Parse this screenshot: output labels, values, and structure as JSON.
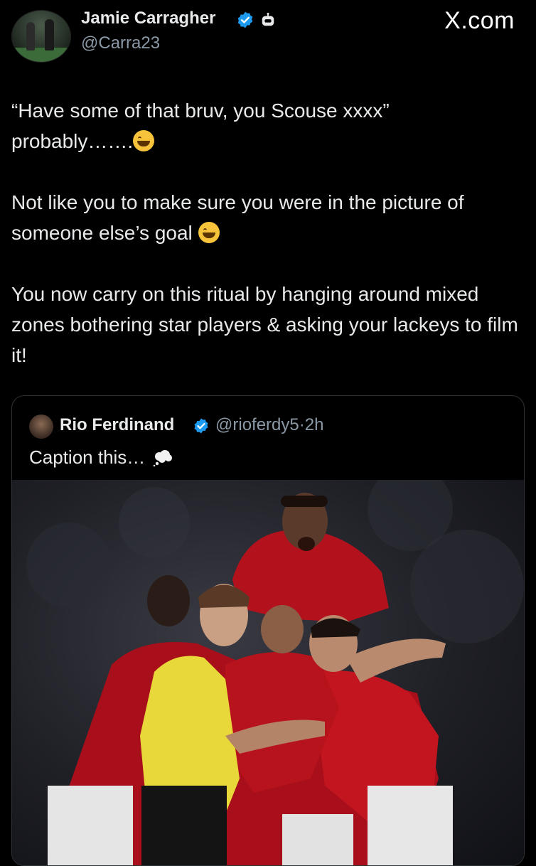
{
  "brand": "X.com",
  "author": {
    "name": "Jamie Carragher",
    "handle": "@Carra23",
    "verified_color": "#1d9bf0"
  },
  "tweet": {
    "p1_line1": "“Have some of that bruv, you Scouse xxxx”",
    "p1_line2": "probably…….",
    "p2": "Not like you to make sure you were in the picture of someone else’s goal",
    "p3": "You now carry on this ritual by hanging around mixed zones bothering star players & asking your lackeys to film it!"
  },
  "quoted": {
    "name": "Rio Ferdinand",
    "handle": "@rioferdy5",
    "separator": "·",
    "time": "2h",
    "text": "Caption this…"
  },
  "icons": {
    "verified": "verified-badge-icon",
    "bot": "automated-account-icon",
    "emoji1": "tears-of-joy-emoji",
    "emoji2": "grinning-sweat-emoji",
    "emoji3": "thought-balloon-emoji"
  }
}
